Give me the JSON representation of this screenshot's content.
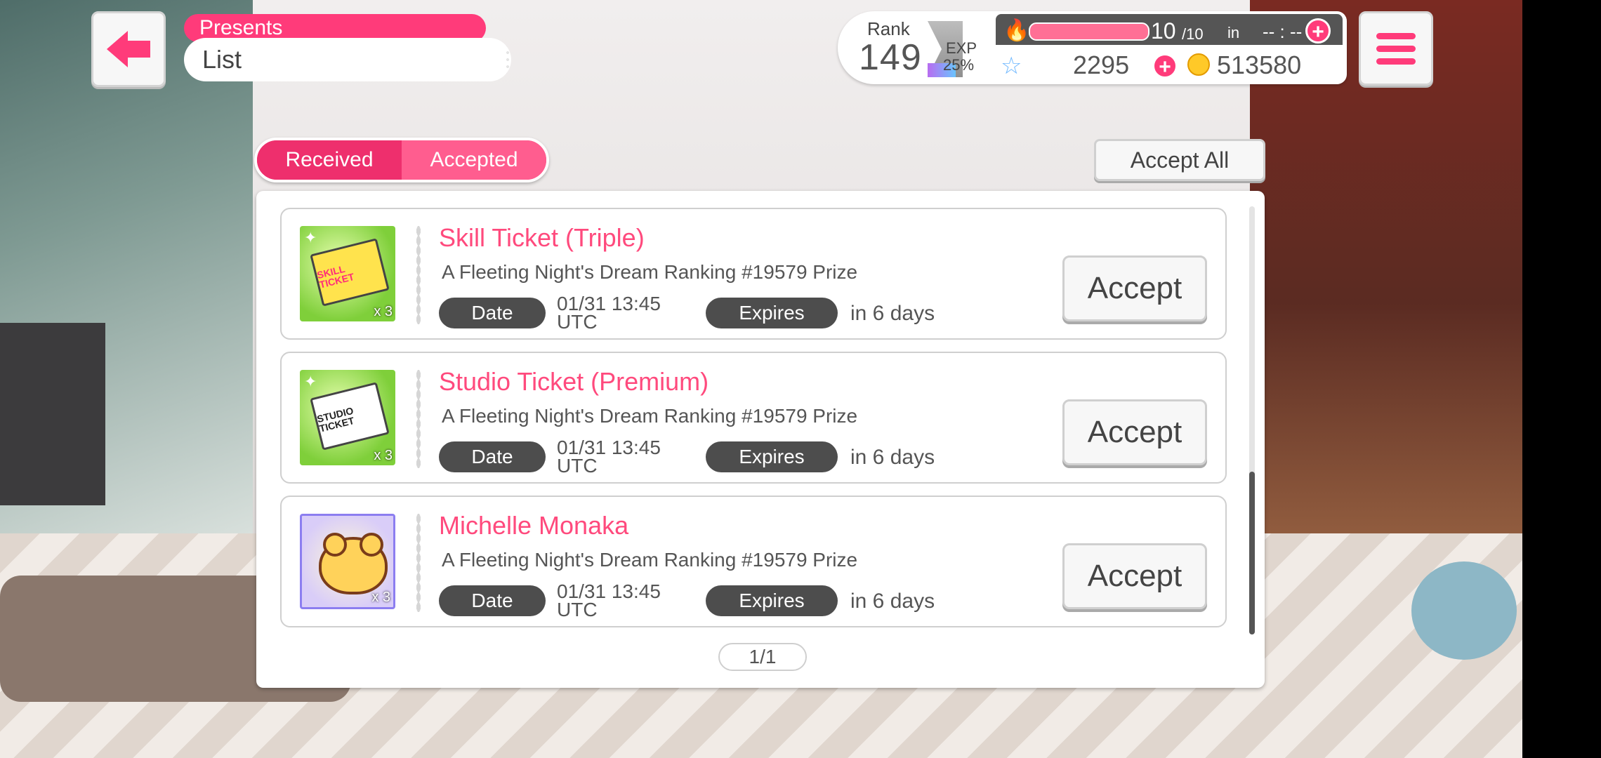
{
  "header": {
    "section_label": "Presents",
    "page_title": "List"
  },
  "status": {
    "rank_label": "Rank",
    "rank_value": "149",
    "exp_label": "EXP",
    "exp_percent": "25%",
    "live_points": "10",
    "live_points_max": "/10",
    "recover_label": "in",
    "recover_timer": "-- : --",
    "star_gems": "2295",
    "coins": "513580",
    "colors": {
      "accent": "#ff3b7a",
      "panel_dark": "#555555"
    }
  },
  "tabs": [
    {
      "label": "Received",
      "selected": true
    },
    {
      "label": "Accepted",
      "selected": false
    }
  ],
  "accept_all_label": "Accept All",
  "presents": [
    {
      "title": "Skill Ticket (Triple)",
      "source": "A Fleeting Night's Dream Ranking #19579 Prize",
      "date_label": "Date",
      "date_value_line1": "01/31 13:45",
      "date_value_line2": "UTC",
      "expires_label": "Expires",
      "expires_value": "in 6 days",
      "quantity": "x 3",
      "icon_text_1": "SKILL TICKET",
      "icon": "skill-ticket-icon",
      "accept_label": "Accept"
    },
    {
      "title": "Studio Ticket (Premium)",
      "source": "A Fleeting Night's Dream Ranking #19579 Prize",
      "date_label": "Date",
      "date_value_line1": "01/31 13:45",
      "date_value_line2": "UTC",
      "expires_label": "Expires",
      "expires_value": "in 6 days",
      "quantity": "x 3",
      "icon_text_1": "STUDIO TICKET",
      "icon": "studio-ticket-icon",
      "accept_label": "Accept"
    },
    {
      "title": "Michelle Monaka",
      "source": "A Fleeting Night's Dream Ranking #19579 Prize",
      "date_label": "Date",
      "date_value_line1": "01/31 13:45",
      "date_value_line2": "UTC",
      "expires_label": "Expires",
      "expires_value": "in 6 days",
      "quantity": "x 3",
      "icon": "monaka-icon",
      "accept_label": "Accept"
    }
  ],
  "pagination": "1/1"
}
